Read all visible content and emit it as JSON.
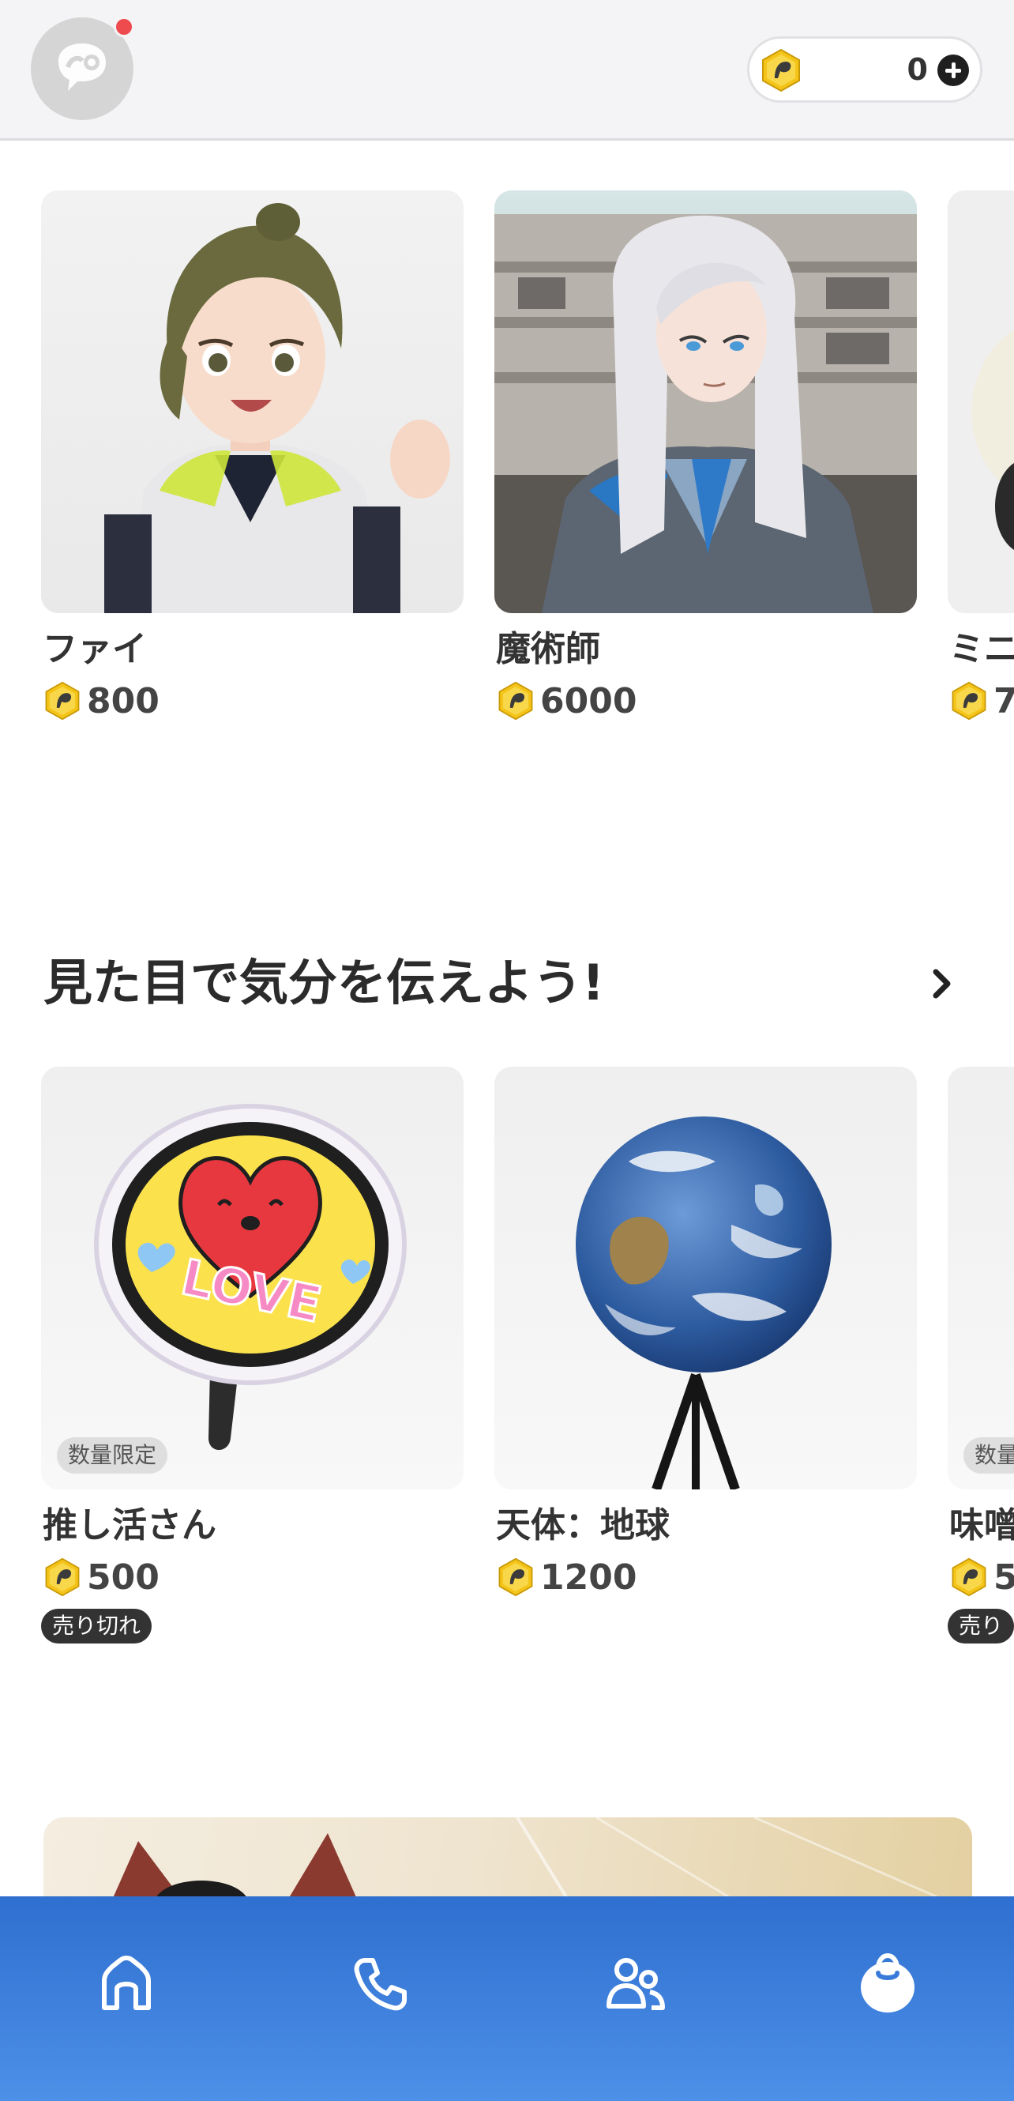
{
  "header": {
    "coin_count": "0"
  },
  "shop_row_1": {
    "items": [
      {
        "name": "ファイ",
        "price": "800"
      },
      {
        "name": "魔術師",
        "price": "6000"
      },
      {
        "name": "ミニ",
        "price": "7"
      }
    ]
  },
  "section_2": {
    "title": "見た目で気分を伝えよう!",
    "items": [
      {
        "name": "推し活さん",
        "price": "500",
        "badge": "数量限定",
        "status": "売り切れ"
      },
      {
        "name": "天体：地球",
        "price": "1200"
      },
      {
        "name": "味噌",
        "price": "5",
        "badge": "数量",
        "status": "売り"
      }
    ]
  },
  "bottom_nav": {
    "items": [
      {
        "icon": "home-icon"
      },
      {
        "icon": "phone-icon"
      },
      {
        "icon": "friends-icon"
      },
      {
        "icon": "shop-bag-icon",
        "active": true
      }
    ]
  },
  "colors": {
    "nav_gradient_top": "#2f6fcf",
    "nav_gradient_bottom": "#4c90e8",
    "coin_gold": "#f2c21b",
    "notification_red": "#ee4b4f"
  }
}
